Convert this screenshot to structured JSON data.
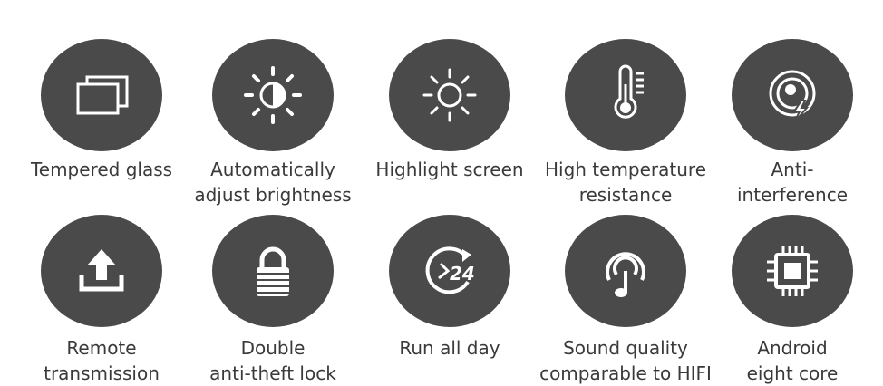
{
  "colors": {
    "circle": "#4a4a4a",
    "icon": "#ffffff",
    "text": "#3a3a3a",
    "background": "#ffffff"
  },
  "features": [
    {
      "icon": "tempered-glass-icon",
      "lines": [
        "Tempered glass"
      ]
    },
    {
      "icon": "auto-brightness-icon",
      "lines": [
        "Automatically",
        "adjust brightness"
      ]
    },
    {
      "icon": "sun-icon",
      "lines": [
        "Highlight screen"
      ]
    },
    {
      "icon": "thermometer-icon",
      "lines": [
        "High temperature",
        "resistance"
      ]
    },
    {
      "icon": "anti-interference-icon",
      "lines": [
        "Anti-",
        "interference"
      ]
    },
    {
      "icon": "upload-icon",
      "lines": [
        "Remote",
        "transmission"
      ]
    },
    {
      "icon": "lock-icon",
      "lines": [
        "Double",
        "anti-theft lock"
      ]
    },
    {
      "icon": "clock-24-icon",
      "lines": [
        "Run all day"
      ]
    },
    {
      "icon": "music-note-icon",
      "lines": [
        "Sound quality",
        "comparable to HIFI"
      ]
    },
    {
      "icon": "cpu-chip-icon",
      "lines": [
        "Android",
        "eight core"
      ]
    }
  ]
}
